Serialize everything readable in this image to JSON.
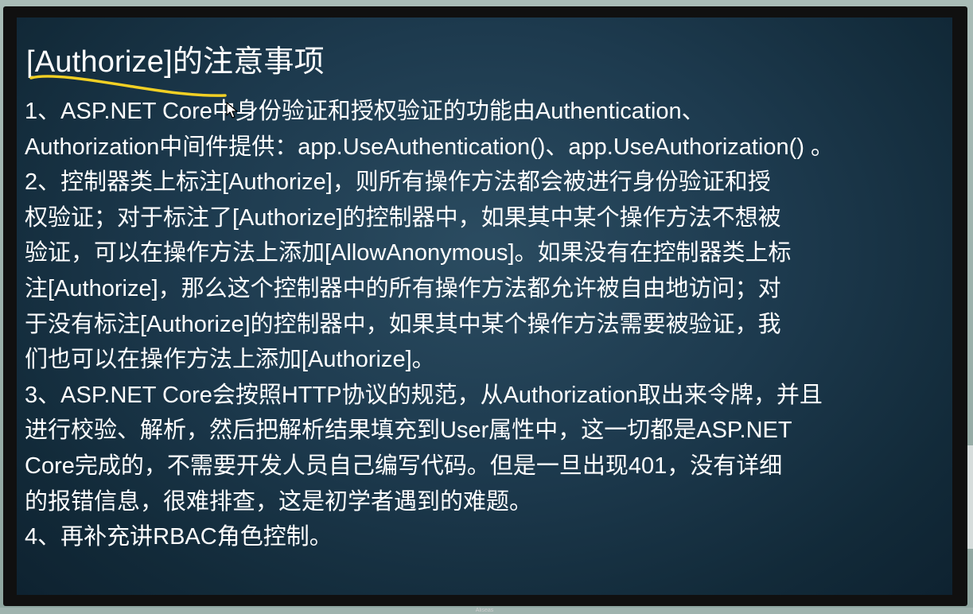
{
  "slide": {
    "title": "[Authorize]的注意事项",
    "paragraphs": [
      {
        "lines": [
          "1、ASP.NET Core中身份验证和授权验证的功能由Authentication、",
          "Authorization中间件提供：app.UseAuthentication()、app.UseAuthorization() 。"
        ]
      },
      {
        "lines": [
          "2、控制器类上标注[Authorize]，则所有操作方法都会被进行身份验证和授",
          "权验证；对于标注了[Authorize]的控制器中，如果其中某个操作方法不想被",
          "验证，可以在操作方法上添加[AllowAnonymous]。如果没有在控制器类上标",
          "注[Authorize]，那么这个控制器中的所有操作方法都允许被自由地访问；对",
          "于没有标注[Authorize]的控制器中，如果其中某个操作方法需要被验证，我",
          "们也可以在操作方法上添加[Authorize]。"
        ]
      },
      {
        "lines": [
          "3、ASP.NET Core会按照HTTP协议的规范，从Authorization取出来令牌，并且",
          "进行校验、解析，然后把解析结果填充到User属性中，这一切都是ASP.NET",
          "Core完成的，不需要开发人员自己编写代码。但是一旦出现401，没有详细",
          "的报错信息，很难排查，这是初学者遇到的难题。"
        ]
      },
      {
        "lines": [
          "4、再补充讲RBAC角色控制。"
        ]
      }
    ]
  },
  "annotation": {
    "pen_color": "#f2d024"
  },
  "monitor": {
    "caption": "Aliseas"
  }
}
